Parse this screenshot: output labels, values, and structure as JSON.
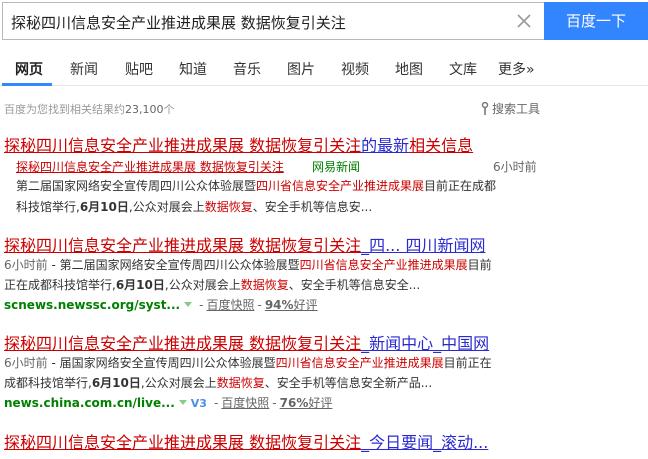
{
  "search": {
    "query": "探秘四川信息安全产业推进成果展 数据恢复引关注",
    "button": "百度一下"
  },
  "tabs": [
    "网页",
    "新闻",
    "贴吧",
    "知道",
    "音乐",
    "图片",
    "视频",
    "地图",
    "文库",
    "更多»"
  ],
  "info": {
    "count_prefix": "百度为您找到相关结果约",
    "count_value": "23,100",
    "count_suffix": "个",
    "tools_label": "搜索工具"
  },
  "results": [
    {
      "title_em": "探秘四川信息安全产业推进成果展 数据恢复引关注",
      "title_tail_plain": "的最新",
      "title_tail_em": "相关信息",
      "sub_title": "探秘四川信息安全产业推进成果展 数据恢复引关注",
      "sub_source": "网易新闻",
      "sub_time": "6小时前",
      "snippet1_a": "第二届国家网络安全宣传周四川公众体验展暨",
      "snippet1_em": "四川省信息安全产业推进成果展",
      "snippet1_b": "目前正在成都",
      "snippet2_a": "科技馆举行,",
      "snippet2_date": "6月10日",
      "snippet2_b": ",公众对展会上",
      "snippet2_em": "数据恢复",
      "snippet2_c": "、安全手机等信息安..."
    },
    {
      "title_em": "探秘四川信息安全产业推进成果展 数据恢复引关注",
      "title_tail": "_四... 四川新闻网",
      "time": "6小时前",
      "snippet1_a": " - 第二届国家网络安全宣传周四川公众体验展暨",
      "snippet1_em": "四川省信息安全产业推进成果展",
      "snippet1_b": "目前",
      "snippet2_a": "正在成都科技馆举行,",
      "snippet2_date": "6月10日",
      "snippet2_b": ",公众对展会上",
      "snippet2_em": "数据恢复",
      "snippet2_c": "、安全手机等信息安全...",
      "url": "scnews.newssc.org/syst...",
      "cache": "百度快照",
      "score": "94%",
      "score_label": "好评"
    },
    {
      "title_em": "探秘四川信息安全产业推进成果展 数据恢复引关注",
      "title_tail": "_新闻中心_中国网",
      "time": "6小时前",
      "snippet1_a": " - 届国家网络安全宣传周四川公众体验展暨",
      "snippet1_em": "四川省信息安全产业推进成果展",
      "snippet1_b": "目前正在",
      "snippet2_a": "成都科技馆举行,",
      "snippet2_date": "6月10日",
      "snippet2_b": ",公众对展会上",
      "snippet2_em": "数据恢复",
      "snippet2_c": "、安全手机等信息安全新产品...",
      "url": "news.china.com.cn/live...",
      "v_badge": "V3",
      "cache": "百度快照",
      "score": "76%",
      "score_label": "好评"
    },
    {
      "title_em": "探秘四川信息安全产业推进成果展 数据恢复引关注",
      "title_tail": "_今日要闻_滚动..."
    }
  ]
}
